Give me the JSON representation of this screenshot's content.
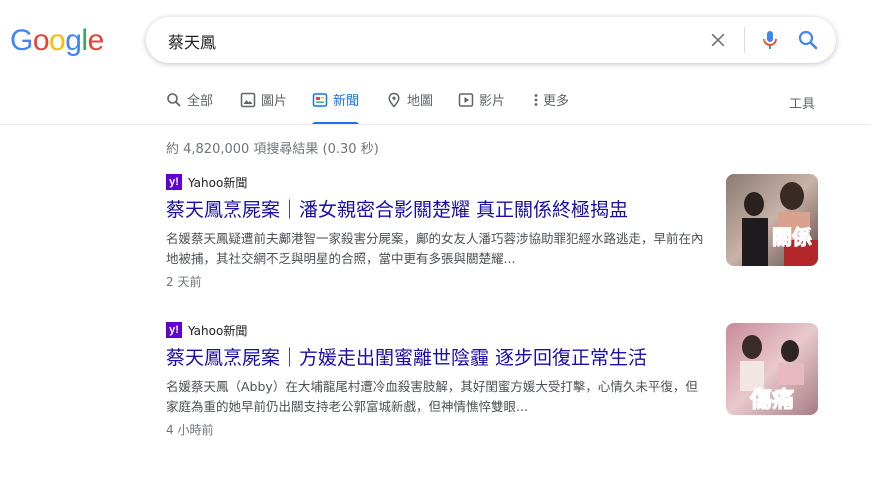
{
  "logo": {
    "letters": [
      "G",
      "o",
      "o",
      "g",
      "l",
      "e"
    ],
    "colors": [
      "#4285F4",
      "#EA4335",
      "#FBBC05",
      "#4285F4",
      "#34A853",
      "#EA4335"
    ]
  },
  "search": {
    "query": "蔡天鳳",
    "icons": [
      "clear-icon",
      "mic-icon",
      "search-icon"
    ]
  },
  "tabs": [
    {
      "label": "全部",
      "icon": "search-icon"
    },
    {
      "label": "圖片",
      "icon": "image-icon"
    },
    {
      "label": "新聞",
      "icon": "news-icon",
      "active": true
    },
    {
      "label": "地圖",
      "icon": "map-pin-icon"
    },
    {
      "label": "影片",
      "icon": "video-icon"
    },
    {
      "label": "更多",
      "icon": "more-vert-icon"
    }
  ],
  "tools_label": "工具",
  "stats": "約 4,820,000 項搜尋結果 (0.30 秒)",
  "results": [
    {
      "source": "Yahoo新聞",
      "source_icon_text": "y!",
      "title": "蔡天鳳烹屍案｜潘女親密合影關楚耀 真正關係終極揭盅",
      "snippet": "名媛蔡天鳳疑遭前夫鄺港智一家殺害分屍案，鄺的女友人潘巧蓉涉協助罪犯經水路逃走，早前在內地被捕，其社交網不乏與明星的合照，當中更有多張與關楚耀...",
      "time": "2 天前",
      "thumb_text": "關係"
    },
    {
      "source": "Yahoo新聞",
      "source_icon_text": "y!",
      "title": "蔡天鳳烹屍案｜方媛走出閨蜜離世陰霾 逐步回復正常生活",
      "snippet": "名媛蔡天鳳（Abby）在大埔龍尾村遭冷血殺害肢解，其好閨蜜方媛大受打擊，心情久未平復，但家庭為重的她早前仍出關支持老公郭富城新戲，但神情憔悴雙眼...",
      "time": "4 小時前",
      "thumb_text": "傷痛"
    }
  ],
  "colors": {
    "link": "#1a0dab",
    "accent": "#1a73e8",
    "yahoo": "#6001d2"
  }
}
